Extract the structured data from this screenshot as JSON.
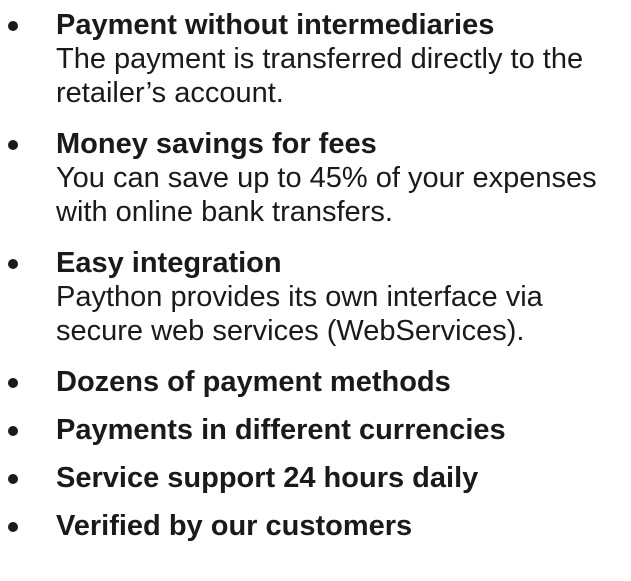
{
  "features": [
    {
      "title": "Payment without intermediaries",
      "description": "The payment is transferred directly to the retailer’s account."
    },
    {
      "title": "Money savings for fees",
      "description": "You can save up to 45% of your expenses with online bank transfers."
    },
    {
      "title": "Easy integration",
      "description": "Paython provides its own interface via secure web services (WebServices)."
    },
    {
      "title": "Dozens of payment methods"
    },
    {
      "title": "Payments in different currencies"
    },
    {
      "title": "Service support 24 hours daily"
    },
    {
      "title": "Verified by our customers"
    }
  ]
}
